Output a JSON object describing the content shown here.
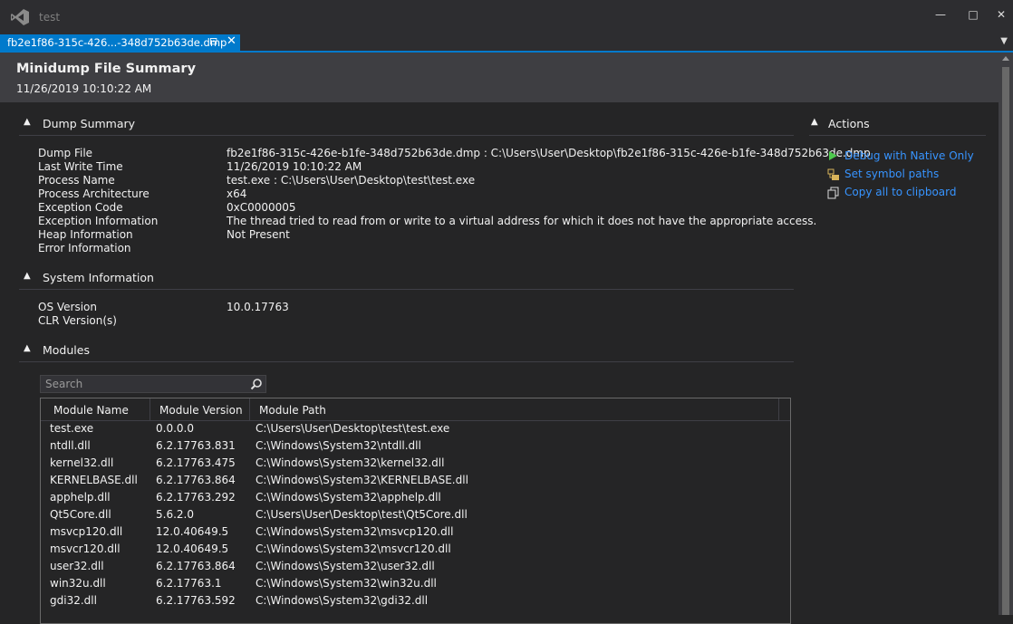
{
  "app": {
    "title": "test"
  },
  "window_controls": {
    "minimize": "—",
    "maximize": "□",
    "close": "✕"
  },
  "tab": {
    "label": "fb2e1f86-315c-426...-348d752b63de.dmp",
    "pin": "⊡",
    "close": "✕"
  },
  "tab_dropdown": "▼",
  "header": {
    "title": "Minidump File Summary",
    "date": "11/26/2019 10:10:22 AM"
  },
  "sections": {
    "dump_summary": {
      "title": "Dump Summary",
      "rows": [
        {
          "key": "Dump File",
          "value": "fb2e1f86-315c-426e-b1fe-348d752b63de.dmp : C:\\Users\\User\\Desktop\\fb2e1f86-315c-426e-b1fe-348d752b63de.dmp"
        },
        {
          "key": "Last Write Time",
          "value": "11/26/2019 10:10:22 AM"
        },
        {
          "key": "Process Name",
          "value": "test.exe : C:\\Users\\User\\Desktop\\test\\test.exe"
        },
        {
          "key": "Process Architecture",
          "value": "x64"
        },
        {
          "key": "Exception Code",
          "value": "0xC0000005"
        },
        {
          "key": "Exception Information",
          "value": "The thread tried to read from or write to a virtual address for which it does not have the appropriate access."
        },
        {
          "key": "Heap Information",
          "value": "Not Present"
        },
        {
          "key": "Error Information",
          "value": ""
        }
      ]
    },
    "system_information": {
      "title": "System Information",
      "rows": [
        {
          "key": "OS Version",
          "value": "10.0.17763"
        },
        {
          "key": "CLR Version(s)",
          "value": ""
        }
      ]
    },
    "modules": {
      "title": "Modules",
      "search_placeholder": "Search",
      "columns": [
        "Module Name",
        "Module Version",
        "Module Path"
      ],
      "rows": [
        [
          "test.exe",
          "0.0.0.0",
          "C:\\Users\\User\\Desktop\\test\\test.exe"
        ],
        [
          "ntdll.dll",
          "6.2.17763.831",
          "C:\\Windows\\System32\\ntdll.dll"
        ],
        [
          "kernel32.dll",
          "6.2.17763.475",
          "C:\\Windows\\System32\\kernel32.dll"
        ],
        [
          "KERNELBASE.dll",
          "6.2.17763.864",
          "C:\\Windows\\System32\\KERNELBASE.dll"
        ],
        [
          "apphelp.dll",
          "6.2.17763.292",
          "C:\\Windows\\System32\\apphelp.dll"
        ],
        [
          "Qt5Core.dll",
          "5.6.2.0",
          "C:\\Users\\User\\Desktop\\test\\Qt5Core.dll"
        ],
        [
          "msvcp120.dll",
          "12.0.40649.5",
          "C:\\Windows\\System32\\msvcp120.dll"
        ],
        [
          "msvcr120.dll",
          "12.0.40649.5",
          "C:\\Windows\\System32\\msvcr120.dll"
        ],
        [
          "user32.dll",
          "6.2.17763.864",
          "C:\\Windows\\System32\\user32.dll"
        ],
        [
          "win32u.dll",
          "6.2.17763.1",
          "C:\\Windows\\System32\\win32u.dll"
        ],
        [
          "gdi32.dll",
          "6.2.17763.592",
          "C:\\Windows\\System32\\gdi32.dll"
        ]
      ]
    }
  },
  "actions": {
    "title": "Actions",
    "items": [
      {
        "label": "Debug with Native Only",
        "icon": "play-icon"
      },
      {
        "label": "Set symbol paths",
        "icon": "symbol-paths-icon"
      },
      {
        "label": "Copy all to clipboard",
        "icon": "copy-icon"
      }
    ]
  },
  "colors": {
    "accent": "#007acc",
    "link": "#3794ff",
    "play": "#4ec94e",
    "background": "#252526",
    "header": "#3e3e42"
  }
}
